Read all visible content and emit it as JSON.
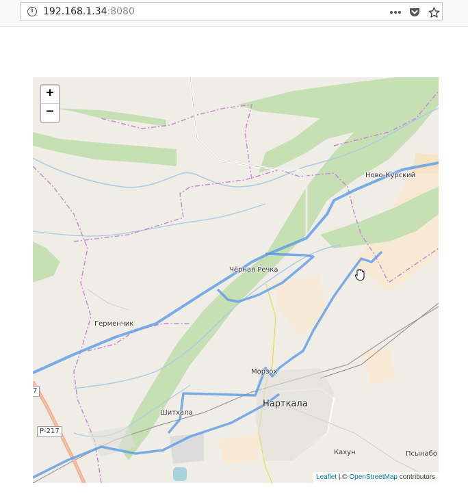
{
  "browser": {
    "url_host": "192.168.1.34",
    "url_port": ":8080",
    "icons": [
      "info-icon",
      "more-icon",
      "pocket-icon",
      "star-icon"
    ]
  },
  "map": {
    "zoom_in_label": "+",
    "zoom_out_label": "−",
    "places": {
      "novo_kursky": "Ново-Курский",
      "chernaya_rechka": "Чёрная Речка",
      "germenchik": "Герменчик",
      "morzoh": "Морзох",
      "nartkala": "Нарткала",
      "shitkhala": "Шитхала",
      "kakhun": "Кахун",
      "psynabo": "Псынабо"
    },
    "road_shields": {
      "p217_a": "Р-217",
      "p217_b": "7"
    },
    "attribution": {
      "leaflet": "Leaflet",
      "separator": " | © ",
      "osm": "OpenStreetMap",
      "contributors": " contributors"
    },
    "colors": {
      "route": "#5b9ae6",
      "forest": "#c6dfb3",
      "river": "#a9cbe6",
      "boundary": "#c58ad1",
      "land": "#f0ede7",
      "farmland": "#f7e9d3"
    }
  }
}
